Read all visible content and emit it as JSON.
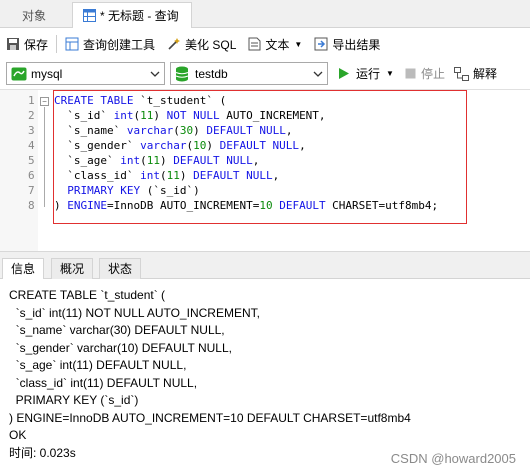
{
  "tabs": {
    "objects": "对象",
    "query": "* 无标题 - 查询"
  },
  "toolbar": {
    "save": "保存",
    "query_builder": "查询创建工具",
    "beautify_sql": "美化 SQL",
    "text": "文本",
    "export": "导出结果"
  },
  "connection": {
    "value": "mysql"
  },
  "database": {
    "value": "testdb"
  },
  "actions": {
    "run": "运行",
    "stop": "停止",
    "explain": "解释"
  },
  "editor": {
    "line_numbers": [
      "1",
      "2",
      "3",
      "4",
      "5",
      "6",
      "7",
      "8"
    ],
    "lines": [
      [
        {
          "t": "CREATE TABLE",
          "k": "kw"
        },
        {
          "t": " `t_student` (",
          "k": ""
        }
      ],
      [
        {
          "t": "  `s_id` ",
          "k": ""
        },
        {
          "t": "int",
          "k": "kw"
        },
        {
          "t": "(",
          "k": ""
        },
        {
          "t": "11",
          "k": "num"
        },
        {
          "t": ") ",
          "k": ""
        },
        {
          "t": "NOT NULL",
          "k": "kw"
        },
        {
          "t": " AUTO_INCREMENT,",
          "k": ""
        }
      ],
      [
        {
          "t": "  `s_name` ",
          "k": ""
        },
        {
          "t": "varchar",
          "k": "kw"
        },
        {
          "t": "(",
          "k": ""
        },
        {
          "t": "30",
          "k": "num"
        },
        {
          "t": ") ",
          "k": ""
        },
        {
          "t": "DEFAULT NULL",
          "k": "kw"
        },
        {
          "t": ",",
          "k": ""
        }
      ],
      [
        {
          "t": "  `s_gender` ",
          "k": ""
        },
        {
          "t": "varchar",
          "k": "kw"
        },
        {
          "t": "(",
          "k": ""
        },
        {
          "t": "10",
          "k": "num"
        },
        {
          "t": ") ",
          "k": ""
        },
        {
          "t": "DEFAULT NULL",
          "k": "kw"
        },
        {
          "t": ",",
          "k": ""
        }
      ],
      [
        {
          "t": "  `s_age` ",
          "k": ""
        },
        {
          "t": "int",
          "k": "kw"
        },
        {
          "t": "(",
          "k": ""
        },
        {
          "t": "11",
          "k": "num"
        },
        {
          "t": ") ",
          "k": ""
        },
        {
          "t": "DEFAULT NULL",
          "k": "kw"
        },
        {
          "t": ",",
          "k": ""
        }
      ],
      [
        {
          "t": "  `class_id` ",
          "k": ""
        },
        {
          "t": "int",
          "k": "kw"
        },
        {
          "t": "(",
          "k": ""
        },
        {
          "t": "11",
          "k": "num"
        },
        {
          "t": ") ",
          "k": ""
        },
        {
          "t": "DEFAULT NULL",
          "k": "kw"
        },
        {
          "t": ",",
          "k": ""
        }
      ],
      [
        {
          "t": "  ",
          "k": ""
        },
        {
          "t": "PRIMARY KEY",
          "k": "kw"
        },
        {
          "t": " (`s_id`)",
          "k": ""
        }
      ],
      [
        {
          "t": ") ",
          "k": ""
        },
        {
          "t": "ENGINE",
          "k": "kw"
        },
        {
          "t": "=InnoDB ",
          "k": ""
        },
        {
          "t": "AUTO_INCREMENT",
          "k": ""
        },
        {
          "t": "=",
          "k": ""
        },
        {
          "t": "10",
          "k": "num"
        },
        {
          "t": " ",
          "k": ""
        },
        {
          "t": "DEFAULT",
          "k": "kw"
        },
        {
          "t": " CHARSET=utf8mb4;",
          "k": ""
        }
      ]
    ]
  },
  "result_tabs": {
    "info": "信息",
    "overview": "概况",
    "status": "状态"
  },
  "output_lines": [
    "CREATE TABLE `t_student` (",
    "  `s_id` int(11) NOT NULL AUTO_INCREMENT,",
    "  `s_name` varchar(30) DEFAULT NULL,",
    "  `s_gender` varchar(10) DEFAULT NULL,",
    "  `s_age` int(11) DEFAULT NULL,",
    "  `class_id` int(11) DEFAULT NULL,",
    "  PRIMARY KEY (`s_id`)",
    ") ENGINE=InnoDB AUTO_INCREMENT=10 DEFAULT CHARSET=utf8mb4",
    "OK",
    "时间: 0.023s"
  ],
  "watermark": "CSDN @howard2005",
  "colors": {
    "keyword": "#1414e6",
    "number": "#0a8a0a",
    "highlight_box": "#e03030",
    "run_green": "#2aa52a"
  }
}
